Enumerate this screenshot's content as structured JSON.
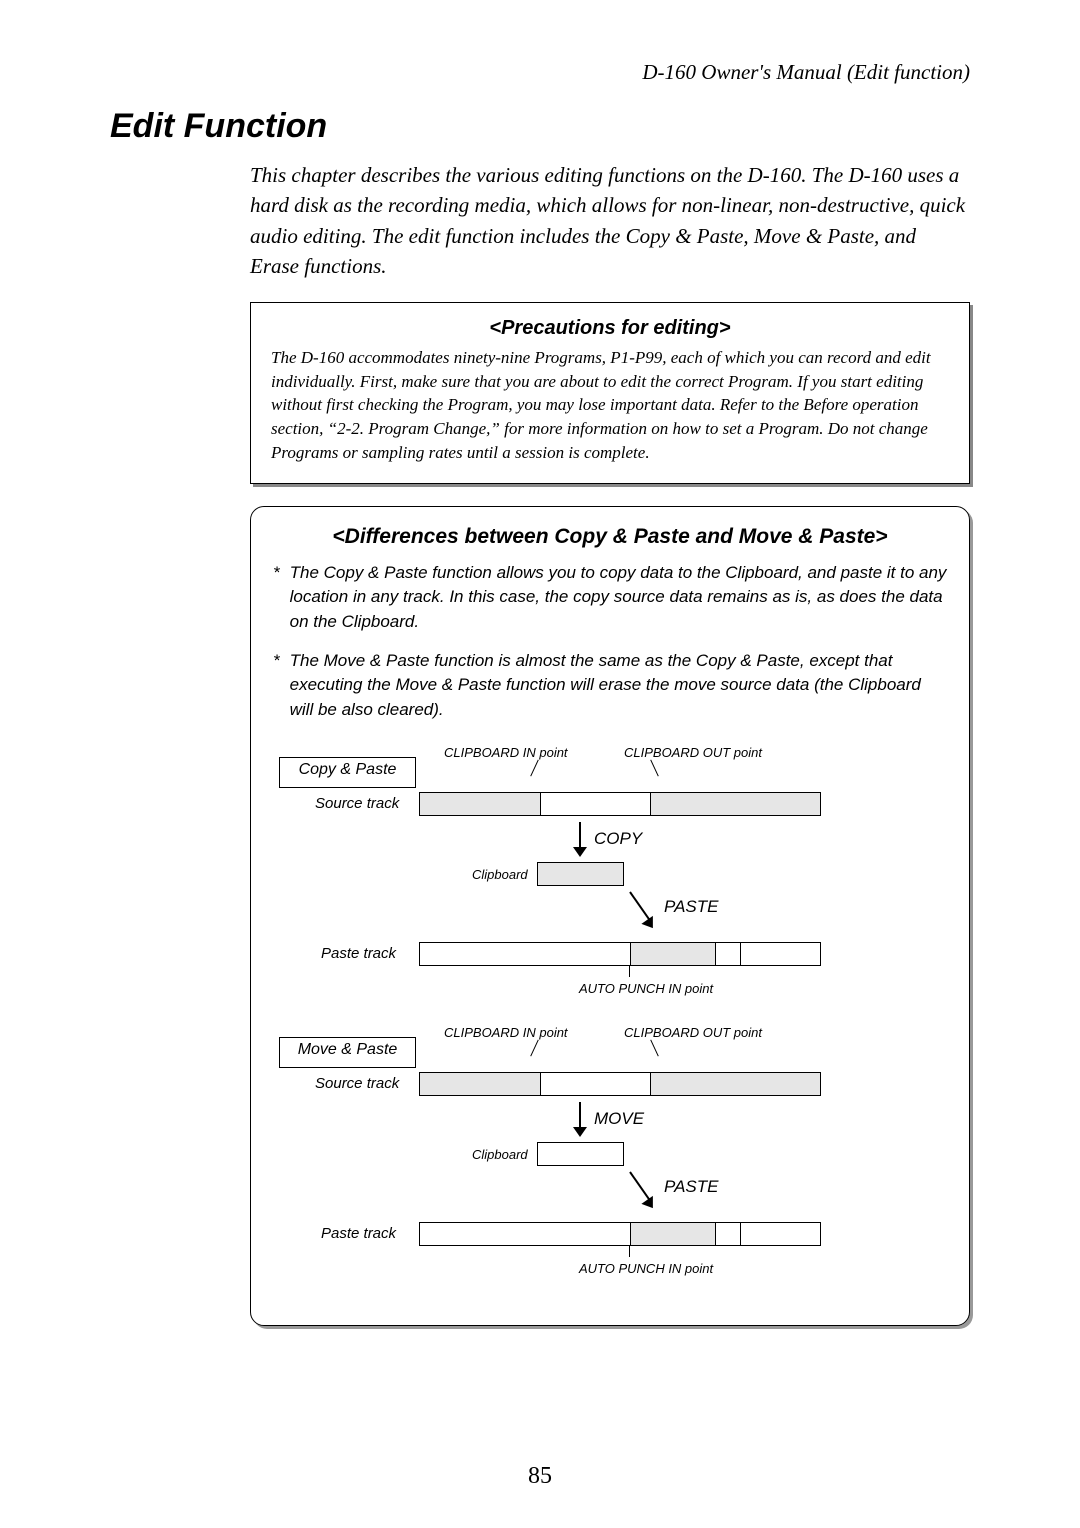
{
  "header": "D-160 Owner's Manual (Edit function)",
  "title": "Edit Function",
  "intro": "This chapter describes the various editing functions on the D-160. The D-160 uses a hard disk as the recording media, which allows for non-linear, non-destructive, quick audio editing.  The edit function includes the Copy & Paste, Move & Paste, and Erase functions.",
  "precautions": {
    "title": "<Precautions for editing>",
    "body": "The D-160 accommodates ninety-nine Programs, P1-P99, each of which you can record and edit individually. First, make sure that you are about to edit the correct Program. If you start editing without first checking the Program, you may lose important data. Refer to the Before operation section, “2-2. Program Change,” for more information on how to set a Program. Do not change Programs or sampling rates until a session is complete."
  },
  "differences": {
    "title": "<Differences between Copy & Paste and Move & Paste>",
    "bullet1": "The Copy & Paste function allows you to copy data to the Clipboard, and paste it to any location in any track. In this case, the copy source data remains as is, as does the data on the Clipboard.",
    "bullet2": "The Move & Paste function is almost the same as the Copy & Paste, except that executing the Move & Paste function will erase the move source data (the Clipboard will be also cleared)."
  },
  "diagram": {
    "copy_title": "Copy & Paste",
    "move_title": "Move & Paste",
    "source_track": "Source track",
    "paste_track": "Paste track",
    "clipboard": "Clipboard",
    "clip_in": "CLIPBOARD IN point",
    "clip_out": "CLIPBOARD OUT point",
    "auto_punch": "AUTO PUNCH IN point",
    "copy": "COPY",
    "move": "MOVE",
    "paste": "PASTE"
  },
  "page_number": "85"
}
